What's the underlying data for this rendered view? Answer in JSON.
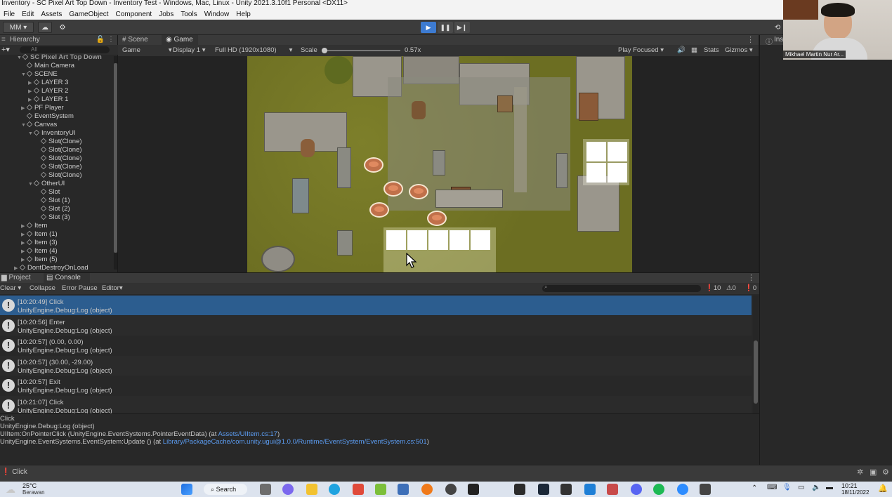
{
  "window": {
    "title": "Inventory - SC Pixel Art Top Down - Inventory Test - Windows, Mac, Linux - Unity 2021.3.10f1 Personal <DX11>"
  },
  "menu": [
    "File",
    "Edit",
    "Assets",
    "GameObject",
    "Component",
    "Jobs",
    "Tools",
    "Window",
    "Help"
  ],
  "toolbar": {
    "account": "MM",
    "play_icon": "play-icon",
    "pause_icon": "pause-icon",
    "step_icon": "step-icon"
  },
  "hierarchy": {
    "title": "Hierarchy",
    "search_placeholder": "All",
    "items": [
      {
        "label": "SC Pixel Art Top Down",
        "indent": 0,
        "arrow": "▼"
      },
      {
        "label": "Main Camera",
        "indent": 1,
        "arrow": ""
      },
      {
        "label": "SCENE",
        "indent": 1,
        "arrow": "▼"
      },
      {
        "label": "LAYER 3",
        "indent": 2,
        "arrow": "▶"
      },
      {
        "label": "LAYER 2",
        "indent": 2,
        "arrow": "▶"
      },
      {
        "label": "LAYER 1",
        "indent": 2,
        "arrow": "▶"
      },
      {
        "label": "PF Player",
        "indent": 1,
        "arrow": "▶"
      },
      {
        "label": "EventSystem",
        "indent": 1,
        "arrow": ""
      },
      {
        "label": "Canvas",
        "indent": 1,
        "arrow": "▼"
      },
      {
        "label": "InventoryUI",
        "indent": 2,
        "arrow": "▼"
      },
      {
        "label": "Slot(Clone)",
        "indent": 3,
        "arrow": ""
      },
      {
        "label": "Slot(Clone)",
        "indent": 3,
        "arrow": ""
      },
      {
        "label": "Slot(Clone)",
        "indent": 3,
        "arrow": ""
      },
      {
        "label": "Slot(Clone)",
        "indent": 3,
        "arrow": ""
      },
      {
        "label": "Slot(Clone)",
        "indent": 3,
        "arrow": ""
      },
      {
        "label": "OtherUI",
        "indent": 2,
        "arrow": "▼"
      },
      {
        "label": "Slot",
        "indent": 3,
        "arrow": ""
      },
      {
        "label": "Slot (1)",
        "indent": 3,
        "arrow": ""
      },
      {
        "label": "Slot (2)",
        "indent": 3,
        "arrow": ""
      },
      {
        "label": "Slot (3)",
        "indent": 3,
        "arrow": ""
      },
      {
        "label": "Item",
        "indent": 1,
        "arrow": "▶"
      },
      {
        "label": "Item (1)",
        "indent": 1,
        "arrow": "▶"
      },
      {
        "label": "Item (3)",
        "indent": 1,
        "arrow": "▶"
      },
      {
        "label": "Item (4)",
        "indent": 1,
        "arrow": "▶"
      },
      {
        "label": "Item (5)",
        "indent": 1,
        "arrow": "▶"
      },
      {
        "label": "DontDestroyOnLoad",
        "indent": 0,
        "arrow": "▶"
      }
    ]
  },
  "game": {
    "tabs": [
      "Scene",
      "Game"
    ],
    "mode": "Game",
    "display": "Display 1",
    "resolution": "Full HD (1920x1080)",
    "scale_label": "Scale",
    "scale_value": "0.57x",
    "play_focused": "Play Focused",
    "stats": "Stats",
    "gizmos": "Gizmos"
  },
  "inspector": {
    "title": "Insp"
  },
  "console": {
    "tabs": [
      "Project",
      "Console"
    ],
    "buttons": [
      "Clear",
      "Collapse",
      "Error Pause",
      "Editor"
    ],
    "counts": {
      "info": "10",
      "warn": "0",
      "error": "0"
    },
    "logs": [
      {
        "line1": "[10:20:49] Click",
        "line2": "UnityEngine.Debug:Log (object)",
        "selected": true
      },
      {
        "line1": "[10:20:56] Enter",
        "line2": "UnityEngine.Debug:Log (object)",
        "selected": false
      },
      {
        "line1": "[10:20:57] (0.00, 0.00)",
        "line2": "UnityEngine.Debug:Log (object)",
        "selected": false
      },
      {
        "line1": "[10:20:57] (30.00, -29.00)",
        "line2": "UnityEngine.Debug:Log (object)",
        "selected": false
      },
      {
        "line1": "[10:20:57] Exit",
        "line2": "UnityEngine.Debug:Log (object)",
        "selected": false
      },
      {
        "line1": "[10:21:07] Click",
        "line2": "UnityEngine.Debug:Log (object)",
        "selected": false
      }
    ],
    "detail": {
      "l1": "Click",
      "l2": "UnityEngine.Debug:Log (object)",
      "l3_pre": "UIItem:OnPointerClick (UnityEngine.EventSystems.PointerEventData) (at ",
      "l3_link": "Assets/UIItem.cs:17",
      "l3_post": ")",
      "l4_pre": "UnityEngine.EventSystems.EventSystem:Update () (at ",
      "l4_link": "Library/PackageCache/com.unity.ugui@1.0.0/Runtime/EventSystem/EventSystem.cs:501",
      "l4_post": ")"
    }
  },
  "statusbar": {
    "text": "Click"
  },
  "webcam": {
    "name": "Mikhael Martin Nur Ar..."
  },
  "taskbar": {
    "weather_temp": "25°C",
    "weather_desc": "Berawan",
    "search": "Search",
    "time": "10:21",
    "date": "18/11/2022"
  }
}
